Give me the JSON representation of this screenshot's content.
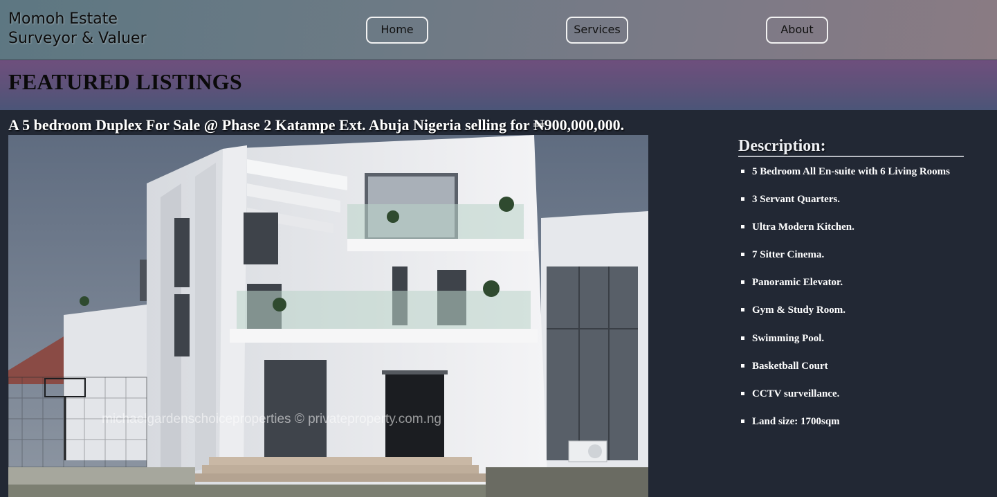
{
  "header": {
    "brand_line1": "Momoh Estate",
    "brand_line2": "Surveyor & Valuer",
    "nav": {
      "home": "Home",
      "services": "Services",
      "about": "About"
    }
  },
  "featured": {
    "title": "FEATURED LISTINGS"
  },
  "listing": {
    "title": "A 5 bedroom Duplex For Sale @ Phase 2 Katampe Ext. Abuja Nigeria selling for ₦900,000,000.",
    "photo_watermark": "michaelgardenschoiceproperties © privateproperty.com.ng"
  },
  "description": {
    "title": "Description:",
    "items": [
      "5 Bedroom All En-suite with 6 Living Rooms",
      "3 Servant Quarters.",
      "Ultra Modern Kitchen.",
      "7 Sitter Cinema.",
      "Panoramic Elevator.",
      "Gym & Study Room.",
      "Swimming Pool.",
      "Basketball Court",
      "CCTV surveillance.",
      "Land size: 1700sqm"
    ]
  },
  "colors": {
    "page_background": "#222834",
    "header_gradient_start": "#5d7782",
    "header_gradient_end": "#8a7b83",
    "featured_band": "#5d5279",
    "text_light": "#ffffff"
  }
}
